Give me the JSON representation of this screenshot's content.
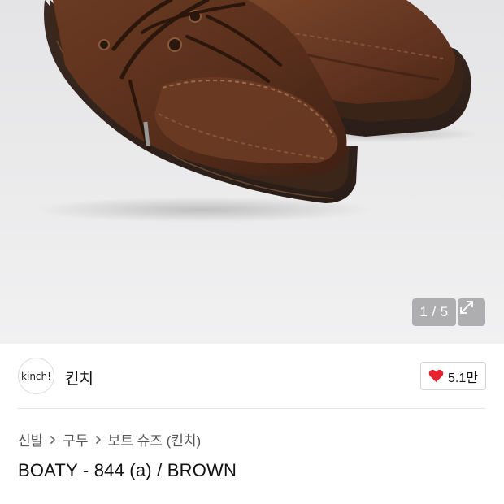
{
  "gallery": {
    "current_page": "1",
    "separator": "/",
    "total_pages": "5",
    "expand_icon": "expand-arrows-icon",
    "image": "brown-leather-boat-shoes"
  },
  "brand": {
    "logo_text": "kinch!",
    "name": "킨치",
    "like_count": "5.1만",
    "like_icon": "heart-icon",
    "heart_color": "#e8212f"
  },
  "breadcrumb": {
    "items": [
      "신발",
      "구두",
      "보트 슈즈 (킨치)"
    ]
  },
  "product": {
    "title": "BOATY - 844 (a) / BROWN"
  }
}
